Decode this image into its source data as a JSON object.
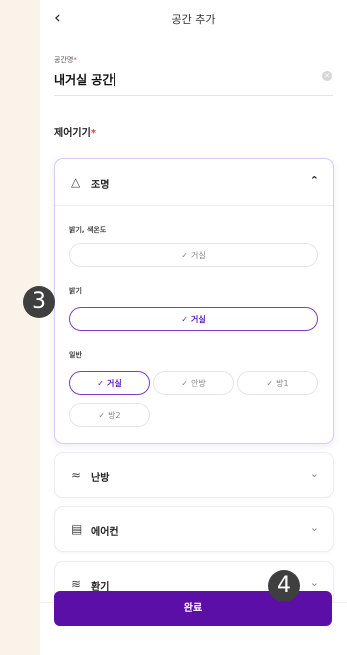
{
  "header": {
    "back_icon": "chevron-left-icon",
    "title": "공간 추가"
  },
  "space_name": {
    "label": "공간명",
    "required_mark": "*",
    "value": "내거실 공간",
    "clear_icon": "clear-icon"
  },
  "devices_section": {
    "label": "제어기기",
    "required_mark": "*"
  },
  "lighting": {
    "title": "조명",
    "icon": "lamp-icon",
    "expanded": true,
    "groups": [
      {
        "label": "밝기, 색온도",
        "options": [
          {
            "label": "거실",
            "selected": false
          }
        ]
      },
      {
        "label": "밝기",
        "options": [
          {
            "label": "거실",
            "selected": true
          }
        ]
      },
      {
        "label": "일반",
        "options": [
          {
            "label": "거실",
            "selected": true
          },
          {
            "label": "안방",
            "selected": false
          },
          {
            "label": "방1",
            "selected": false
          },
          {
            "label": "방2",
            "selected": false
          }
        ]
      }
    ]
  },
  "heating": {
    "title": "난방",
    "icon": "heater-icon"
  },
  "aircon": {
    "title": "에어컨",
    "icon": "aircon-icon"
  },
  "ventilation": {
    "title": "환기",
    "icon": "ventilation-icon"
  },
  "done_button": "완료",
  "annotations": [
    "3",
    "4"
  ],
  "colors": {
    "accent": "#5c0fa6",
    "selected_border": "#7a3ec9",
    "background": "#fbf3ea"
  }
}
